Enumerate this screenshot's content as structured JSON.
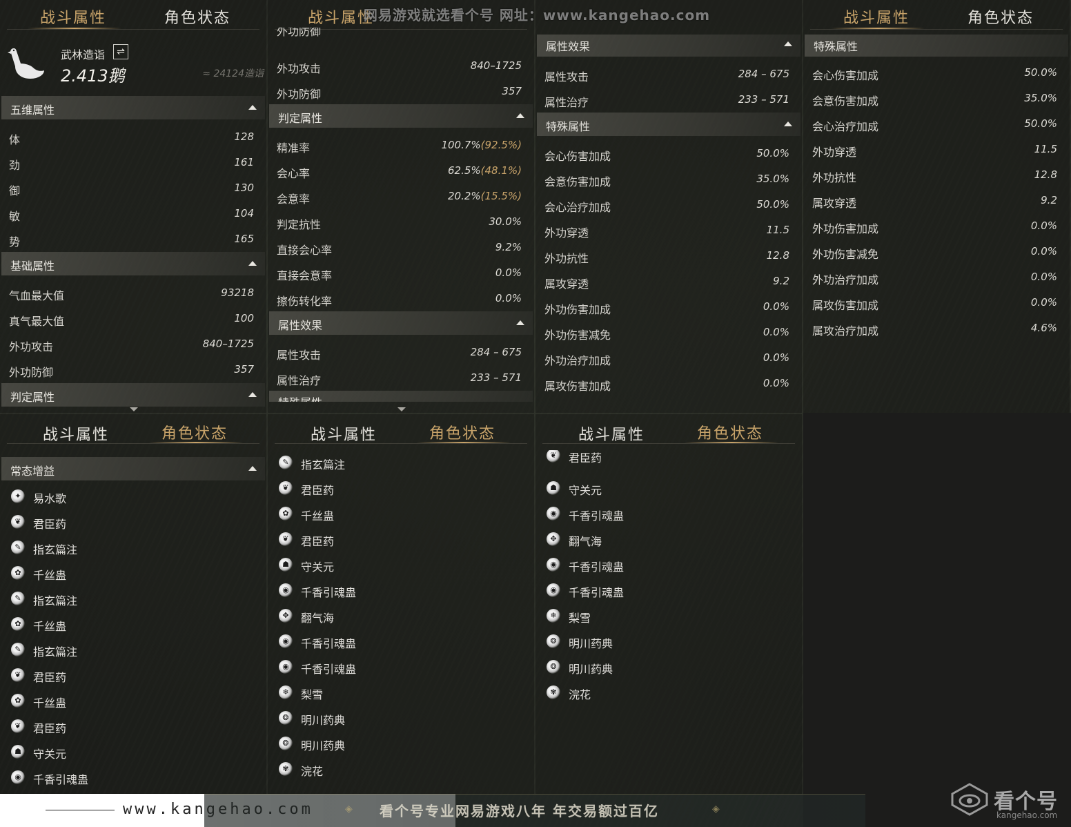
{
  "tabs": {
    "combat": "战斗属性",
    "status": "角色状态"
  },
  "watermark_top": "网易游戏就选看个号  网址：www.kangehao.com",
  "profile": {
    "name": "武林造诣",
    "swap_icon": "⇌",
    "score": "2.413鹅",
    "approx": "≈ 24124造诣"
  },
  "labels": {
    "wuwei": "五维属性",
    "jichu": "基础属性",
    "panding": "判定属性",
    "shuxing": "属性效果",
    "teshu": "特殊属性",
    "changtai": "常态增益",
    "ti": "体",
    "jin": "劲",
    "yu": "御",
    "min": "敏",
    "shi": "势",
    "qixue": "气血最大值",
    "zhenqi": "真气最大值",
    "waigong_atk": "外功攻击",
    "waigong_def": "外功防御",
    "jingzhun": "精准率",
    "huixin": "会心率",
    "huiyi": "会意率",
    "kangxing": "判定抗性",
    "zhijie_huixin": "直接会心率",
    "zhijie_huiyi": "直接会意率",
    "cashang": "擦伤转化率",
    "sx_atk": "属性攻击",
    "sx_heal": "属性治疗",
    "hx_dmg": "会心伤害加成",
    "hy_dmg": "会意伤害加成",
    "hx_heal": "会心治疗加成",
    "wg_pen": "外功穿透",
    "wg_res": "外功抗性",
    "sg_pen": "属攻穿透",
    "wg_dmg": "外功伤害加成",
    "wg_red": "外功伤害减免",
    "wg_heal": "外功治疗加成",
    "sg_dmg": "属攻伤害加成",
    "sg_heal": "属攻治疗加成",
    "cut_top2": "外功防御",
    "cut_top3": "属性效果",
    "cut_top4": "特殊属性",
    "cut_bot2": "特殊属性"
  },
  "values": {
    "ti": "128",
    "jin": "161",
    "yu": "130",
    "min": "104",
    "shi": "165",
    "qixue": "93218",
    "zhenqi": "100",
    "waigong_atk": "840–1725",
    "waigong_def": "357",
    "jingzhun": "100.7%",
    "jingzhun_alt": "(92.5%)",
    "huixin": "62.5%",
    "huixin_alt": "(48.1%)",
    "huiyi": "20.2%",
    "huiyi_alt": "(15.5%)",
    "kangxing": "30.0%",
    "zhijie_huixin": "9.2%",
    "zhijie_huiyi": "0.0%",
    "cashang": "0.0%",
    "sx_atk": "284 – 675",
    "sx_heal": "233 – 571",
    "hx_dmg": "50.0%",
    "hy_dmg": "35.0%",
    "hx_heal": "50.0%",
    "wg_pen": "11.5",
    "wg_res": "12.8",
    "sg_pen": "9.2",
    "wg_dmg": "0.0%",
    "wg_red": "0.0%",
    "wg_heal": "0.0%",
    "sg_dmg": "0.0%",
    "sg_heal": "4.6%"
  },
  "buffs1": [
    "易水歌",
    "君臣药",
    "指玄篇注",
    "千丝蛊",
    "指玄篇注",
    "千丝蛊",
    "指玄篇注",
    "君臣药",
    "千丝蛊",
    "君臣药",
    "守关元",
    "千香引魂蛊"
  ],
  "buffs2": [
    "指玄篇注",
    "君臣药",
    "千丝蛊",
    "君臣药",
    "守关元",
    "千香引魂蛊",
    "翻气海",
    "千香引魂蛊",
    "千香引魂蛊",
    "梨雪",
    "明川药典",
    "明川药典",
    "浣花"
  ],
  "buffs3": [
    "君臣药",
    "守关元",
    "千香引魂蛊",
    "翻气海",
    "千香引魂蛊",
    "千香引魂蛊",
    "梨雪",
    "明川药典",
    "明川药典",
    "浣花"
  ],
  "footer": {
    "url": "www.kangehao.com",
    "slogan": "看个号专业网易游戏八年   年交易额过百亿",
    "orn": "◈"
  },
  "logo": {
    "text": "看个号",
    "sub": "kangehao.com"
  },
  "colors": {
    "accent_gold": "#c9a46a",
    "panel_text": "#d8d6d0"
  }
}
